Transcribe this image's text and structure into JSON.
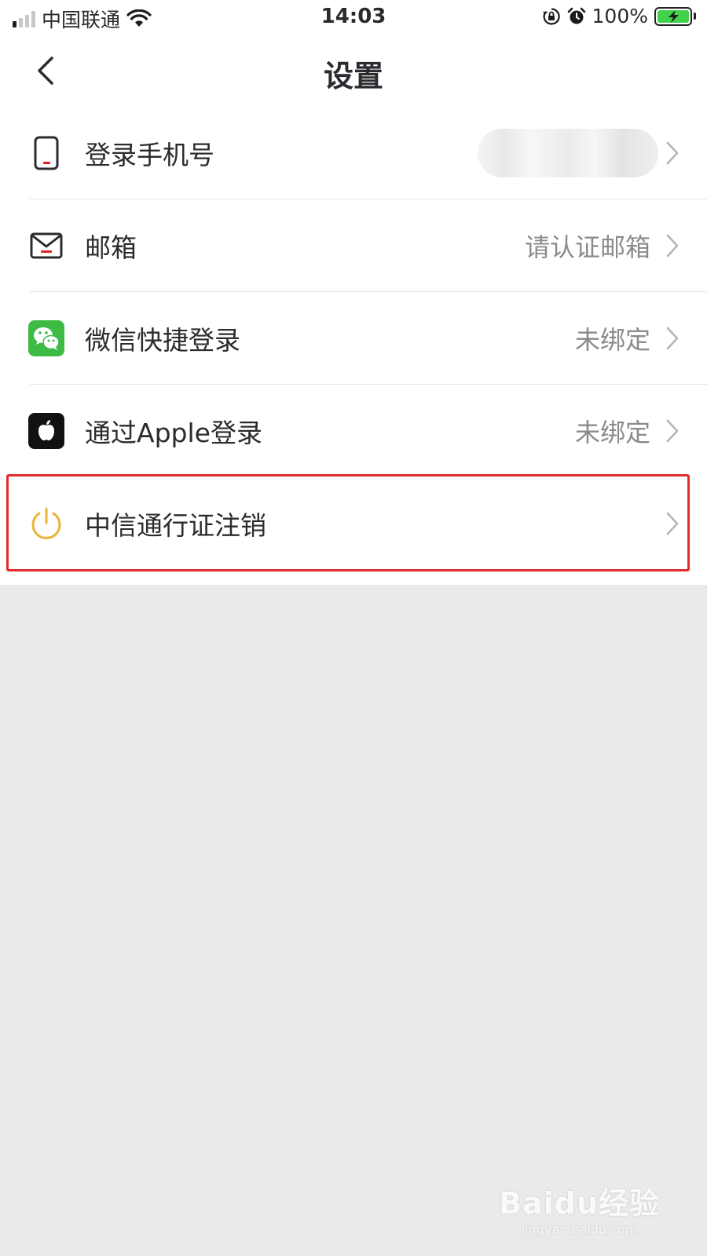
{
  "status_bar": {
    "carrier": "中国联通",
    "time": "14:03",
    "battery_percent": "100%"
  },
  "header": {
    "title": "设置"
  },
  "settings": [
    {
      "label": "登录手机号",
      "value": "",
      "icon": "phone-icon"
    },
    {
      "label": "邮箱",
      "value": "请认证邮箱",
      "icon": "mail-icon"
    },
    {
      "label": "微信快捷登录",
      "value": "未绑定",
      "icon": "wechat-icon"
    },
    {
      "label": "通过Apple登录",
      "value": "未绑定",
      "icon": "apple-icon"
    },
    {
      "label": "中信通行证注销",
      "value": "",
      "icon": "power-icon"
    }
  ],
  "watermark": {
    "main": "Baidu经验",
    "sub": "jingyan.baidu.com"
  },
  "colors": {
    "highlight": "#e22b2b",
    "wechat_green": "#3dbb45",
    "power_yellow": "#e7b53a",
    "accent_red": "#e02020"
  }
}
